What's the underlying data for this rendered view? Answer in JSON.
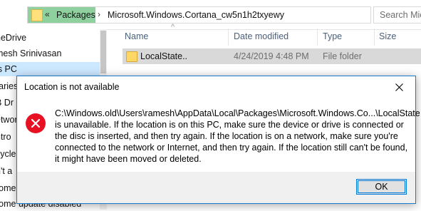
{
  "explorer": {
    "address": {
      "chevrons": "«",
      "crumbs": [
        "Packages",
        "Microsoft.Windows.Cortana_cw5n1h2txyewy"
      ],
      "search_placeholder": "Search Mic"
    },
    "nav_items": [
      {
        "label": "neDrive"
      },
      {
        "label": "mesh Srinivasan"
      },
      {
        "label": "is PC",
        "selected": true
      },
      {
        "label": "raries"
      },
      {
        "label": "B Dr"
      },
      {
        "label": "etwor"
      },
      {
        "label": "ntro"
      },
      {
        "label": "cycle"
      },
      {
        "label": "n't a"
      },
      {
        "label": "rome"
      },
      {
        "label": "rome update disabled"
      }
    ],
    "columns": {
      "name": "Name",
      "date_modified": "Date modified",
      "type": "Type",
      "size": "Size"
    },
    "files": [
      {
        "name": "LocalState..",
        "date_modified": "4/24/2019 4:48 PM",
        "type": "File folder"
      }
    ]
  },
  "dialog": {
    "title": "Location is not available",
    "message": "C:\\Windows.old\\Users\\ramesh\\AppData\\Local\\Packages\\Microsoft.Windows.Co...\\LocalState is unavailable. If the location is on this PC, make sure the device or drive is connected or the disc is inserted, and then try again. If the location is on a network, make sure you're connected to the network or Internet, and then try again. If the location still can't be found, it might have been moved or deleted.",
    "ok_label": "OK",
    "error_icon": "error-icon",
    "accent_color": "#1979ca",
    "error_color": "#e81123"
  }
}
